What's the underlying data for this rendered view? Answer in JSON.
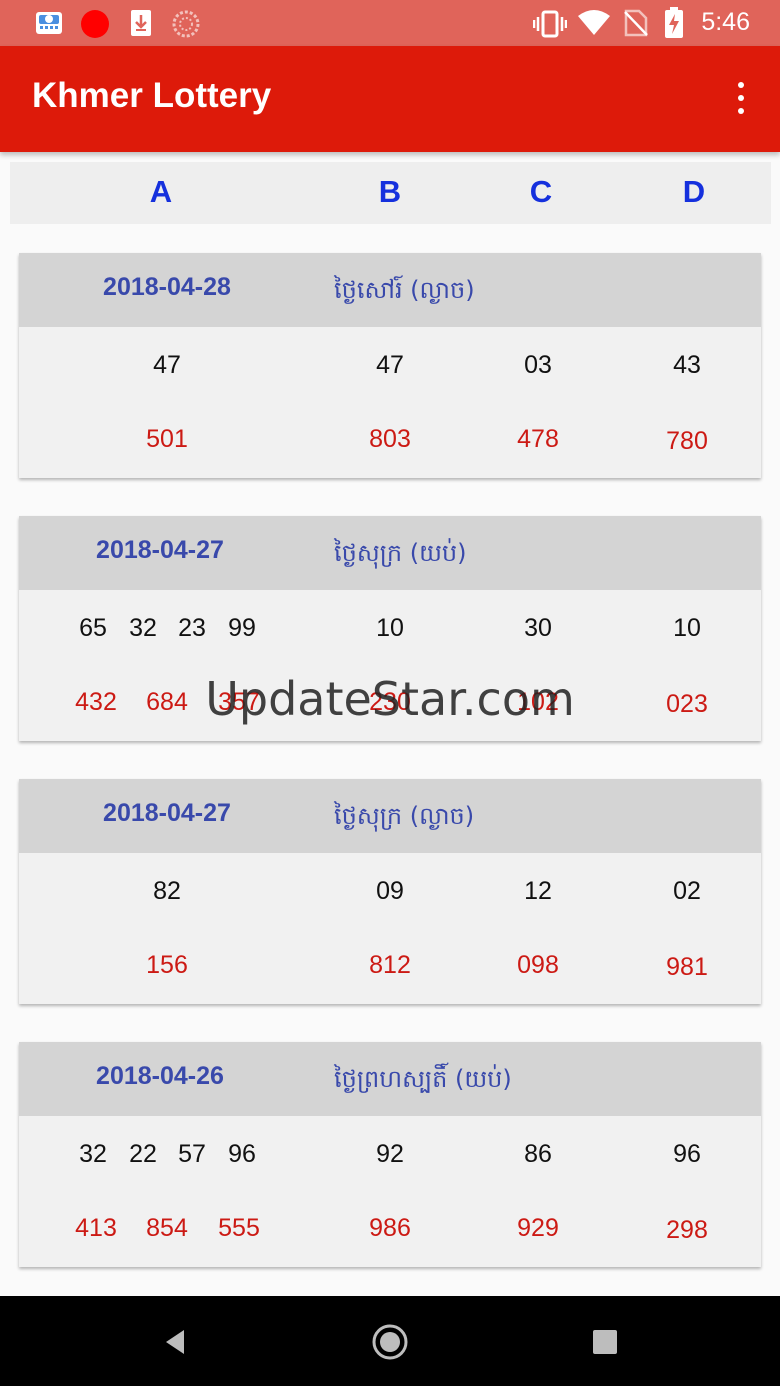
{
  "status_bar": {
    "time": "5:46",
    "icons": [
      "weather-app-icon",
      "record-dot-icon",
      "download-icon",
      "sync-icon",
      "vibrate-icon",
      "wifi-icon",
      "no-sim-icon",
      "battery-charging-icon"
    ]
  },
  "app_bar": {
    "title": "Khmer Lottery",
    "menu_icon": "overflow-menu-icon"
  },
  "columns": [
    "A",
    "B",
    "C",
    "D"
  ],
  "results": [
    {
      "date": "2018-04-28",
      "day": "ថ្ងៃសៅរ៍ (ល្ងាច)",
      "a2": [
        "47"
      ],
      "a3": [
        "501"
      ],
      "b2": "47",
      "b3": "803",
      "c2": "03",
      "c3": "478",
      "d2": "43",
      "d3": "780"
    },
    {
      "date": "2018-04-27",
      "day": "ថ្ងៃសុក្រ (យប់)",
      "a2": [
        "65",
        "32",
        "23",
        "99"
      ],
      "a3": [
        "432",
        "684",
        "357"
      ],
      "b2": "10",
      "b3": "230",
      "c2": "30",
      "c3": "102",
      "d2": "10",
      "d3": "023"
    },
    {
      "date": "2018-04-27",
      "day": "ថ្ងៃសុក្រ (ល្ងាច)",
      "a2": [
        "82"
      ],
      "a3": [
        "156"
      ],
      "b2": "09",
      "b3": "812",
      "c2": "12",
      "c3": "098",
      "d2": "02",
      "d3": "981"
    },
    {
      "date": "2018-04-26",
      "day": "ថ្ងៃព្រហស្បតិ៍ (យប់)",
      "a2": [
        "32",
        "22",
        "57",
        "96"
      ],
      "a3": [
        "413",
        "854",
        "555"
      ],
      "b2": "92",
      "b3": "986",
      "c2": "86",
      "c3": "929",
      "d2": "96",
      "d3": "298"
    }
  ],
  "watermark": "UpdateStar.com",
  "nav_bar": {
    "buttons": [
      "back-icon",
      "home-icon",
      "recents-icon"
    ]
  },
  "colors": {
    "app_bar": "#dd1a0a",
    "status_bar": "#e0645a",
    "column_header_text": "#1530dd",
    "date_text": "#3949ab",
    "red_number": "#cc1a14"
  }
}
